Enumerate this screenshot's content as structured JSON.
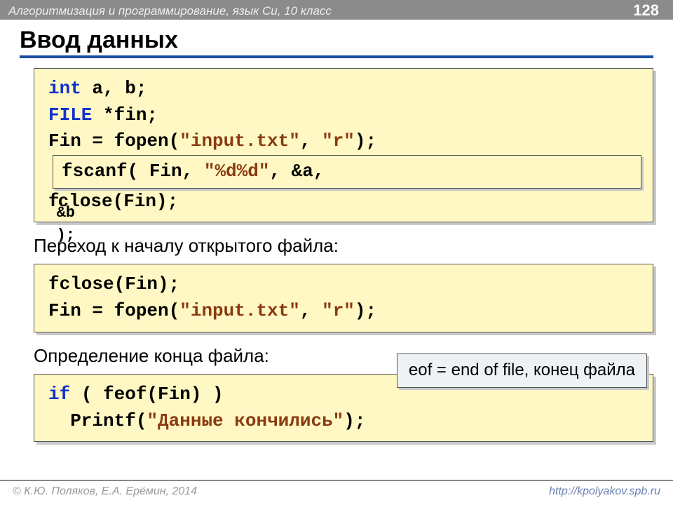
{
  "header": {
    "course": "Алгоритмизация и программирование, язык Си, 10 класс",
    "page": "128"
  },
  "title": "Ввод данных",
  "block1": {
    "l1_kw1": "int",
    "l1_rest": " a, b;",
    "l2_kw1": "FILE",
    "l2_rest": " *fin;",
    "l3_a": "Fin = fopen(",
    "l3_str": "\"input.txt\"",
    "l3_b": ", ",
    "l3_str2": "\"r\"",
    "l3_c": ");",
    "inner_a": "fscanf( Fin, ",
    "inner_str": "\"%d%d\"",
    "inner_b": ", &a,",
    "l5_a": "f",
    "l5_inner": "&b );",
    "l5_b": "close(Fin);"
  },
  "sub1": "Переход к началу открытого файла:",
  "block2": {
    "l1": "fclose(Fin);",
    "l2_a": "Fin = fopen(",
    "l2_s1": "\"input.txt\"",
    "l2_b": ", ",
    "l2_s2": "\"r\"",
    "l2_c": ");"
  },
  "sub2": "Определение конца файла:",
  "tooltip": "eof = end of file, конец файла",
  "block3": {
    "l1_a": "if ",
    "l1_b": "( feof(Fin) )",
    "l2_a": "  Printf(",
    "l2_s": "\"Данные кончились\"",
    "l2_b": ");"
  },
  "footer": {
    "credit": "© К.Ю. Поляков, Е.А. Ерёмин, 2014",
    "url": "http://kpolyakov.spb.ru"
  }
}
